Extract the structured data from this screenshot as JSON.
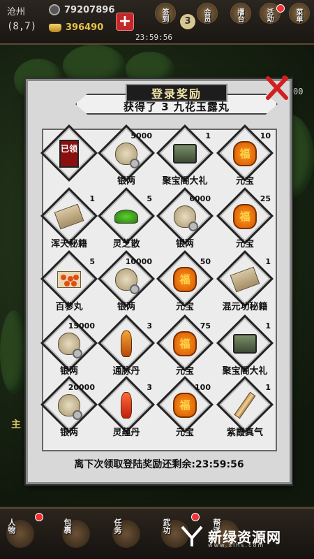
{
  "topbar": {
    "location": "沧州",
    "coord": "(8,7)",
    "silver": "79207896",
    "gold": "396490",
    "timer": "23:59:56",
    "vip_level": "3",
    "menus": [
      {
        "label": "签到"
      },
      {
        "label": "会员"
      },
      {
        "label": "擂台"
      },
      {
        "label": "活动"
      },
      {
        "label": "菜单"
      }
    ]
  },
  "popup": {
    "title": "登录奖励",
    "subtitle": "获得了 3 九花玉露丸",
    "footer_label": "离下次领取登陆奖励还剩余:",
    "footer_time": "23:59:56",
    "items": [
      {
        "name": "",
        "qty": "",
        "art": "claimed",
        "claimed_text": "已领"
      },
      {
        "name": "银两",
        "qty": "5000",
        "art": "bag"
      },
      {
        "name": "聚宝阁大礼",
        "qty": "1",
        "art": "chest"
      },
      {
        "name": "元宝",
        "qty": "10",
        "art": "yb"
      },
      {
        "name": "浑天秘籍",
        "qty": "1",
        "art": "scroll"
      },
      {
        "name": "灵芝散",
        "qty": "5",
        "art": "powder"
      },
      {
        "name": "银两",
        "qty": "6000",
        "art": "bag"
      },
      {
        "name": "元宝",
        "qty": "25",
        "art": "yb"
      },
      {
        "name": "百参丸",
        "qty": "5",
        "art": "pills"
      },
      {
        "name": "银两",
        "qty": "10000",
        "art": "bag"
      },
      {
        "name": "元宝",
        "qty": "50",
        "art": "yb"
      },
      {
        "name": "混元功秘籍",
        "qty": "1",
        "art": "scroll"
      },
      {
        "name": "银两",
        "qty": "15000",
        "art": "bag"
      },
      {
        "name": "通脉丹",
        "qty": "3",
        "art": "bottle"
      },
      {
        "name": "元宝",
        "qty": "75",
        "art": "yb"
      },
      {
        "name": "聚宝阁大礼",
        "qty": "1",
        "art": "chest"
      },
      {
        "name": "银两",
        "qty": "20000",
        "art": "bag"
      },
      {
        "name": "灵蕴丹",
        "qty": "3",
        "art": "bottle-red"
      },
      {
        "name": "元宝",
        "qty": "100",
        "art": "yb"
      },
      {
        "name": "紫霞真气",
        "qty": "1",
        "art": "roll"
      }
    ],
    "yb_char": "福"
  },
  "bottombar": {
    "items": [
      {
        "label": "人物"
      },
      {
        "label": "包裹"
      },
      {
        "label": "任务"
      },
      {
        "label": "武功"
      },
      {
        "label": "帮派"
      }
    ]
  },
  "side_text": "主",
  "right_text": "00",
  "watermark": {
    "name": "新绿资源网",
    "url": "www.xlhs.com"
  },
  "colors": {
    "accent_red": "#c0282a",
    "gold": "#e8c24a",
    "panel": "#d8d8d8"
  }
}
